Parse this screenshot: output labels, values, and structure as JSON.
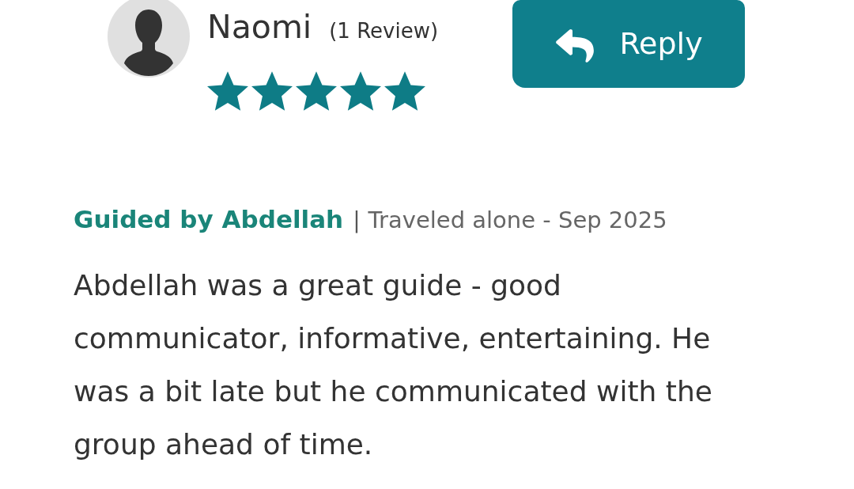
{
  "reviewer": {
    "name": "Naomi",
    "review_count": "(1 Review)",
    "stars": 5
  },
  "reply_button": {
    "label": "Reply"
  },
  "review": {
    "guide": "Guided by Abdellah",
    "separator": "|",
    "trip_info": "Traveled alone - Sep 2025",
    "text": "Abdellah was a great guide - good communicator, informative, entertaining. He was a bit late but he communicated with the group ahead of time."
  }
}
